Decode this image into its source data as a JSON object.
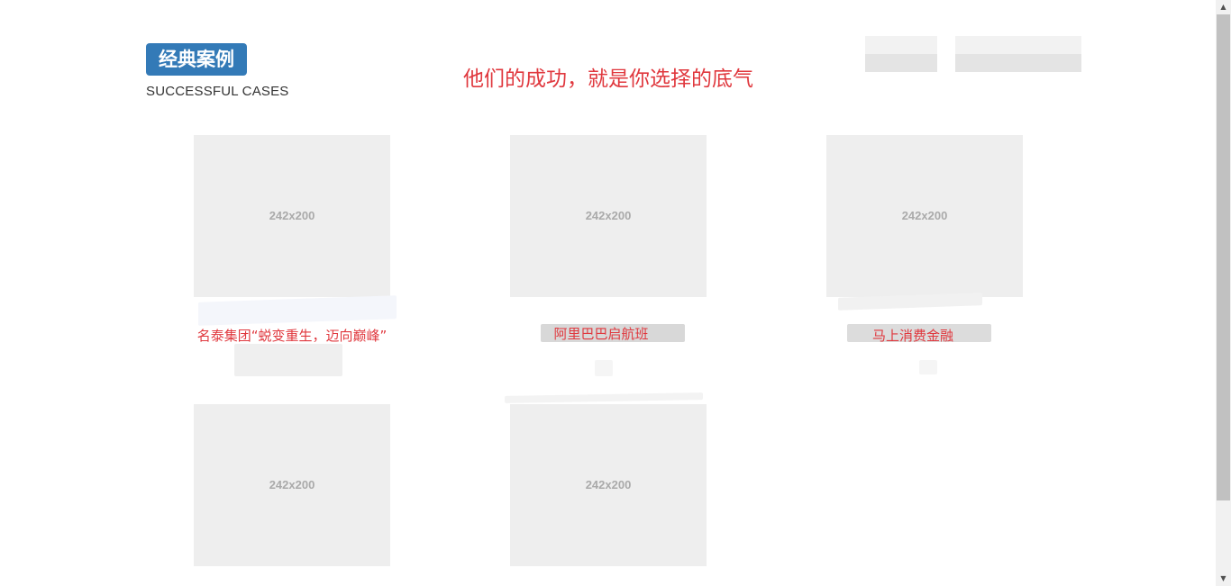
{
  "header": {
    "badge": "经典案例",
    "subtitle": "SUCCESSFUL CASES",
    "slogan": "他们的成功，就是你选择的底气"
  },
  "cases": [
    {
      "placeholder": "242x200",
      "caption": "名泰集团“蜕变重生，迈向巅峰”"
    },
    {
      "placeholder": "242x200",
      "caption": "阿里巴巴启航班"
    },
    {
      "placeholder": "242x200",
      "caption": "马上消费金融"
    },
    {
      "placeholder": "242x200",
      "caption": ""
    },
    {
      "placeholder": "242x200",
      "caption": ""
    }
  ],
  "colors": {
    "badge_bg": "#337ab7",
    "accent_red": "#e0383e",
    "placeholder_bg": "#eeeeee",
    "placeholder_text": "#aaaaaa"
  },
  "icons": {
    "scroll_up": "triangle-up-icon",
    "scroll_down": "triangle-down-icon"
  }
}
